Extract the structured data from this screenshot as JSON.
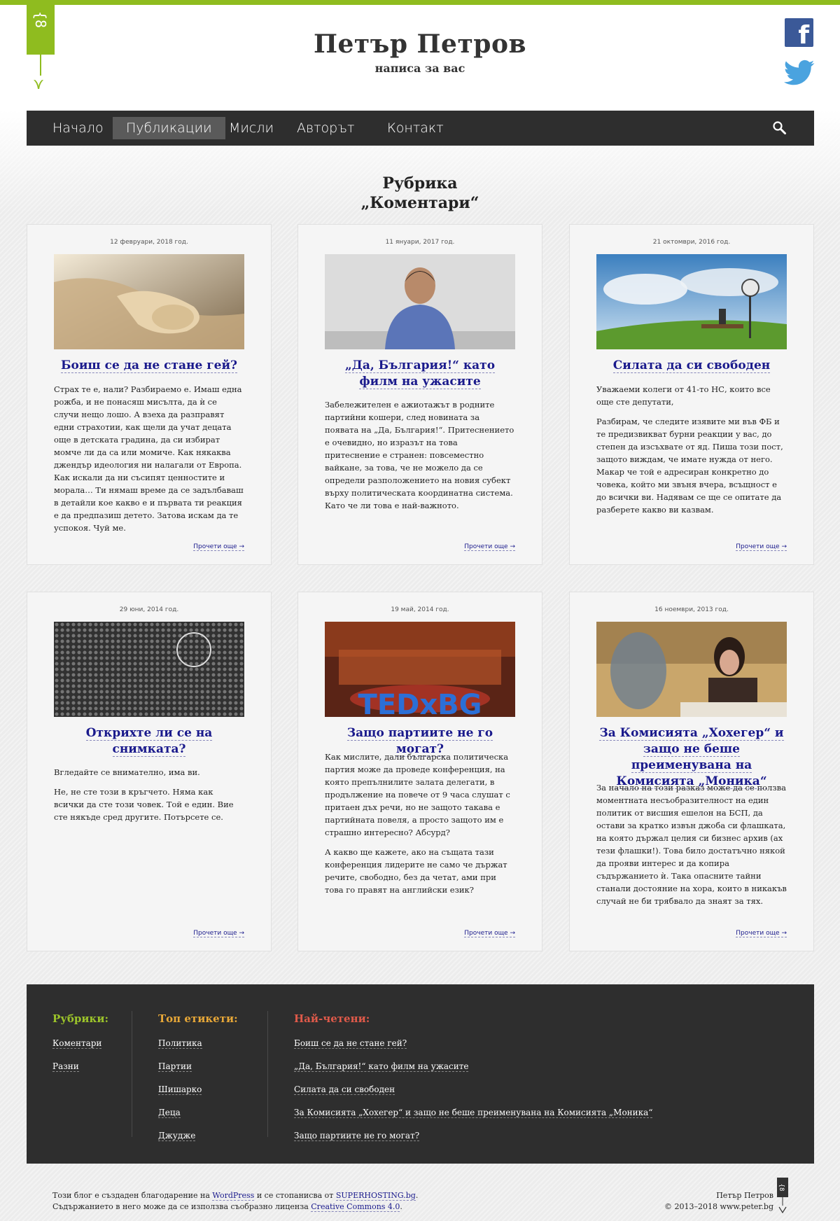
{
  "site": {
    "logo_glyph": "{8",
    "title": "Петър Петров",
    "tagline": "написа за вас"
  },
  "social": {
    "facebook_icon": "facebook-icon",
    "twitter_icon": "twitter-icon",
    "fb_letter": "f"
  },
  "nav": {
    "items": [
      {
        "label": "Начало"
      },
      {
        "label": "Публикации",
        "active": true
      },
      {
        "label": "Мисли"
      },
      {
        "label": "Авторът"
      },
      {
        "label": "Контакт"
      }
    ]
  },
  "page": {
    "title_line1": "Рубрика",
    "title_line2": "„Коментари“"
  },
  "cards": [
    {
      "date": "12 февруари, 2018 год.",
      "title": "Боиш се да не стане гей?",
      "paragraphs": [
        "Страх те е, нали? Разбираемо е. Имаш една рожба, и не понасяш мисълта, да ѝ се случи нещо лошо. А взеха да разправят едни страхотии, как щели да учат децата още в детската градина, да си избират момче ли да са или момиче. Как някаква джендър идеология ни налагали от Европа. Как искали да ни съсипят ценностите и морала… Ти нямаш време да се задълбаваш в детайли кое какво е и първата ти реакция е да предпазиш детето. Затова искам да те успокоя. Чуй ме."
      ],
      "read_more": "Прочети още →"
    },
    {
      "date": "11 януари, 2017 год.",
      "title": "„Да, България!“ като филм на ужасите",
      "paragraphs": [
        "Забележителен е ажиотажът в родните партийни кошери, след новината за появата на „Да, България!“. Притеснението е очевидно, но изразът на това притеснение е странен: повсеместно вайкане, за това, че не можело да се определи разположението на новия субект върху политическата координатна система. Като че ли това е най-важното."
      ],
      "read_more": "Прочети още →"
    },
    {
      "date": "21 октомври, 2016 год.",
      "title": "Силата да си свободен",
      "paragraphs": [
        "Уважаеми колеги от 41-то НС, които все още сте депутати,",
        "Разбирам, че следите изявите ми във ФБ и те предизвикват бурни реакции у вас, до степен да изсъхвате от яд. Пиша този пост, защото виждам, че имате нужда от него. Макар че той е адресиран конкретно до човека, който ми звъня вчера, всъщност е до всички ви. Надявам се ще се опитате да разберете какво ви казвам."
      ],
      "read_more": "Прочети още →"
    },
    {
      "date": "29 юни, 2014 год.",
      "title": "Открихте ли се на снимката?",
      "paragraphs": [
        "Вгледайте се внимателно, има ви.",
        "Не, не сте този в кръгчето. Няма как всички да сте този човек. Той е един. Вие сте някъде сред другите. Потърсете се."
      ],
      "read_more": "Прочети още →"
    },
    {
      "date": "19 май, 2014 год.",
      "title": "Защо партиите не го могат?",
      "paragraphs": [
        "Как мислите, дали българска политическа партия може да проведе конференция, на която препълнилите залата делегати, в продължение на повече от 9 часа слушат с притаен дъх речи, но не защото такава е партийната повеля, а просто защото им е страшно интересно? Абсурд?",
        "А какво ще кажете, ако на същата тази конференция лидерите не само че държат речите, свободно, без да четат, ами при това го правят на английски език?"
      ],
      "read_more": "Прочети още →"
    },
    {
      "date": "16 ноември, 2013 год.",
      "title": "За Комисията „Хохегер“ и защо не беше преименувана на Комисията „Моника“",
      "paragraphs": [
        "За начало на този разказ може да се ползва моментната несъобразителност на един политик от висшия ешелон на БСП, да остави за кратко извън джоба си флашката, на която държал целия си бизнес архив (ах тези флашки!). Това било достатъчно някой да прояви интерес и да копира съдържанието ѝ. Така опасните тайни станали достояние на хора, които в никакъв случай не би трябвало да знаят за тях."
      ],
      "read_more": "Прочети още →"
    }
  ],
  "footer": {
    "categories": {
      "heading": "Рубрики:",
      "items": [
        "Коментари",
        "Разни"
      ]
    },
    "tags": {
      "heading": "Топ етикети:",
      "items": [
        "Политика",
        "Партии",
        "Шишарко",
        "Деца",
        "Джудже"
      ]
    },
    "popular": {
      "heading": "Най-четени:",
      "items": [
        "Боиш се да не стане гей?",
        "„Да, България!“ като филм на ужасите",
        "Силата да си свободен",
        "За Комисията „Хохегер“ и защо не беше преименувана на Комисията „Моника“",
        "Защо партиите не го могат?"
      ]
    },
    "colors": {
      "categories": "#9cc42a",
      "tags": "#e8a838",
      "popular": "#e05a4a"
    }
  },
  "bottom": {
    "line1_prefix": "Този блог е създаден благодарение на ",
    "wordpress": "WordPress",
    "line1_mid": " и се стопанисва от ",
    "superhosting": "SUPERHOSTING.bg",
    "line1_suffix": ".",
    "line2_prefix": "Съдържанието в него може да се използва съобразно лиценза ",
    "license": "Creative Commons 4.0",
    "line2_suffix": ".",
    "author": "Петър Петров",
    "copyright": "© 2013–2018 www.peter.bg"
  }
}
